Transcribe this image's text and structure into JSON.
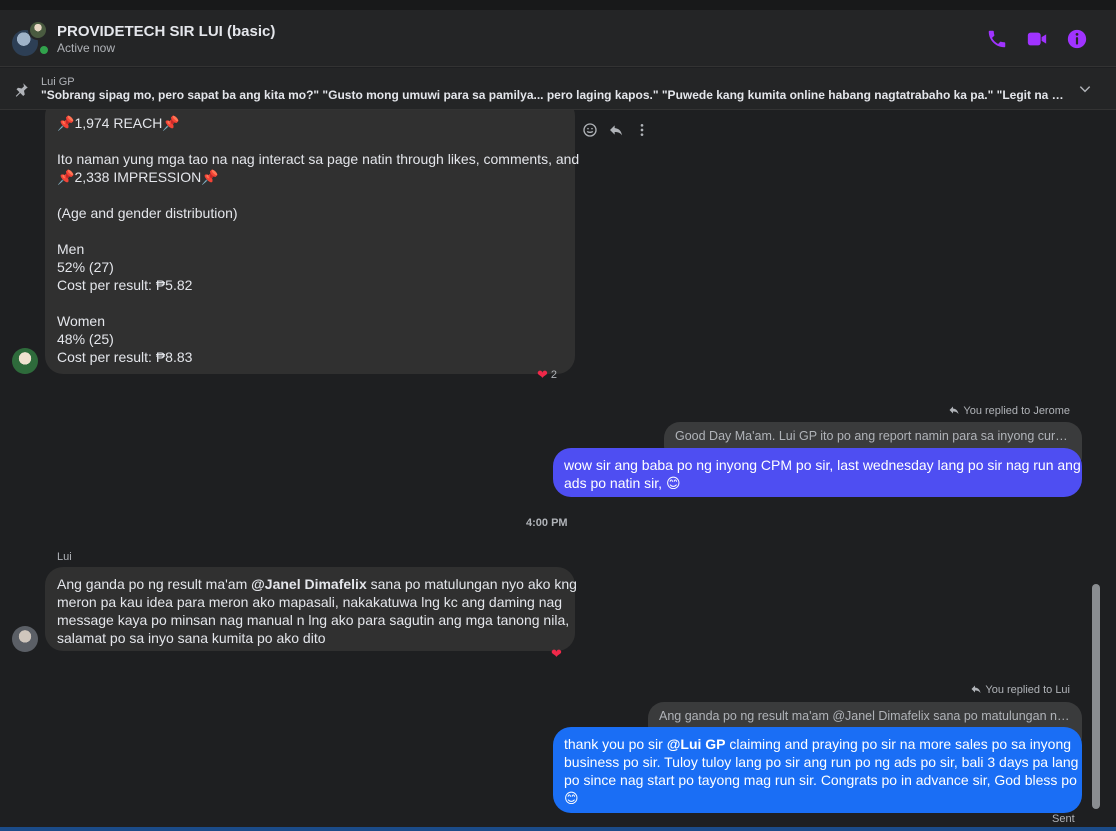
{
  "header": {
    "title": "PROVIDETECH SIR LUI (basic)",
    "status": "Active now",
    "accent": "#a033ff",
    "icons": [
      "phone-icon",
      "video-icon",
      "info-icon"
    ]
  },
  "pinned": {
    "name": "Lui GP",
    "text": "\"Sobrang sipag mo, pero sapat ba ang kita mo?\" \"Gusto mong umuwi para sa pamilya... pero laging kapos.\" \"Puwede kang kumita online habang nagtatrabaho ka pa.\" \"Legit na negosyo, low c..."
  },
  "messages": {
    "m1": {
      "reach_line": "1,974 REACH",
      "interact_line": "Ito naman yung mga tao na nag interact sa page natin through likes, comments, and",
      "impression_line": "2,338 IMPRESSION",
      "age_line": "(Age and gender distribution)",
      "men_label": "Men",
      "men_pct": "52% (27)",
      "men_cost": "Cost per result: ₱5.82",
      "women_label": "Women",
      "women_pct": "48% (25)",
      "women_cost": "Cost per result: ₱8.83",
      "reaction_count": "2"
    },
    "m2": {
      "replied_to": "You replied to Jerome",
      "quote": "Good Day Ma'am. Lui GP  ito po ang report namin para sa inyong current n...",
      "line1": "wow sir ang baba po ng inyong CPM po sir, last wednesday lang po sir nag run ang",
      "line2": "ads po natin sir, 😊",
      "color": "#4e4ef2"
    },
    "timestamp": "4:00 PM",
    "m3": {
      "sender": "Lui",
      "pre_mention": "Ang ganda po ng result ma'am ",
      "mention": "@Janel Dimafelix",
      "post_mention": " sana po matulungan nyo ako kng",
      "line2": "meron pa kau idea para meron ako mapasali, nakakatuwa lng kc ang daming nag",
      "line3": "message kaya po minsan nag manual n lng ako para sagutin ang mga tanong nila,",
      "line4": "salamat po sa inyo sana kumita po ako dito"
    },
    "m4": {
      "replied_to": "You replied to Lui",
      "quote": "Ang ganda po ng result ma'am @Janel Dimafelix sana po matulungan nyo ako...",
      "pre_mention": "thank you po sir ",
      "mention": "@Lui GP",
      "post_mention": " claiming and praying po sir na more sales po sa inyong",
      "line2": "business po sir. Tuloy tuloy lang po sir ang run po ng ads po sir, bali 3 days pa lang",
      "line3": "po since nag start po tayong mag run sir. Congrats po in advance sir, God bless po",
      "line4": "😊",
      "color": "#1a6ef5"
    },
    "sent_status": "Sent"
  }
}
